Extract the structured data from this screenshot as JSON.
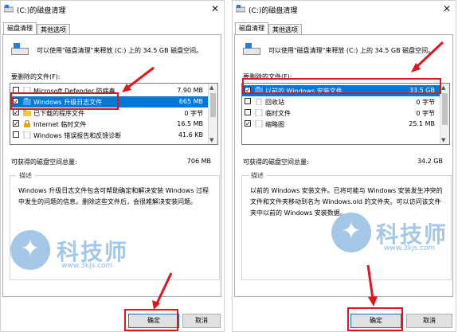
{
  "accent": "#0078d7",
  "highlight_color": "#e0161e",
  "left": {
    "title": "(C:)的磁盘清理",
    "close": "✕",
    "tabs": [
      "磁盘清理",
      "其他选项"
    ],
    "intro": "可以使用\"磁盘清理\"来释放  (C:) 上的 34.5 GB 磁盘空间。",
    "list_label": "要删除的文件(F):",
    "files": [
      {
        "name": "Microsoft Defender 防病毒",
        "size": "7.90 MB",
        "checked": false,
        "icon": "shield-icon"
      },
      {
        "name": "Windows 升级日志文件",
        "size": "665 MB",
        "checked": true,
        "icon": "log-icon"
      },
      {
        "name": "已下载的程序文件",
        "size": "0 字节",
        "checked": true,
        "icon": "folder-icon"
      },
      {
        "name": "Internet 临时文件",
        "size": "16.5 MB",
        "checked": true,
        "icon": "lock-icon"
      },
      {
        "name": "Windows 错误报告和反馈诊断",
        "size": "41.6 KB",
        "checked": false,
        "icon": "file-icon"
      }
    ],
    "total_label": "可获得的磁盘空间总量:",
    "total_value": "706 MB",
    "desc_title": "描述",
    "desc_text": "Windows 升级日志文件包含可帮助确定和解决安装 Windows 过程中发生的问题的信息。删除这些文件后，会很难解决安装问题。",
    "ok": "确定",
    "cancel": "取消"
  },
  "right": {
    "title": "(C:)的磁盘清理",
    "close": "✕",
    "tabs": [
      "磁盘清理",
      "其他选项"
    ],
    "intro": "可以使用\"磁盘清理\"来释放  (C:) 上的 34.5 GB 磁盘空间。",
    "list_label": "要删除的文件(F):",
    "files": [
      {
        "name": "以前的 Windows 安装文件",
        "size": "33.5 GB",
        "checked": true,
        "icon": "windows-icon"
      },
      {
        "name": "回收站",
        "size": "0 字节",
        "checked": false,
        "icon": "recycle-bin-icon"
      },
      {
        "name": "临时文件",
        "size": "0 字节",
        "checked": false,
        "icon": "file-icon"
      },
      {
        "name": "缩略图",
        "size": "25.1 MB",
        "checked": true,
        "icon": "file-icon"
      }
    ],
    "total_label": "可获得的磁盘空间总量:",
    "total_value": "34.2 GB",
    "desc_title": "描述",
    "desc_text": "以前的 Windows 安装文件。已将可能与 Windows 安装发生冲突的文件和文件夹移动到名为 Windows.old 的文件夹。可以访问该文件夹中以前的 Windows 安装数据。",
    "ok": "确定",
    "cancel": "取消"
  },
  "watermark": {
    "text": "科技师",
    "url": "www.3kjs.com"
  }
}
